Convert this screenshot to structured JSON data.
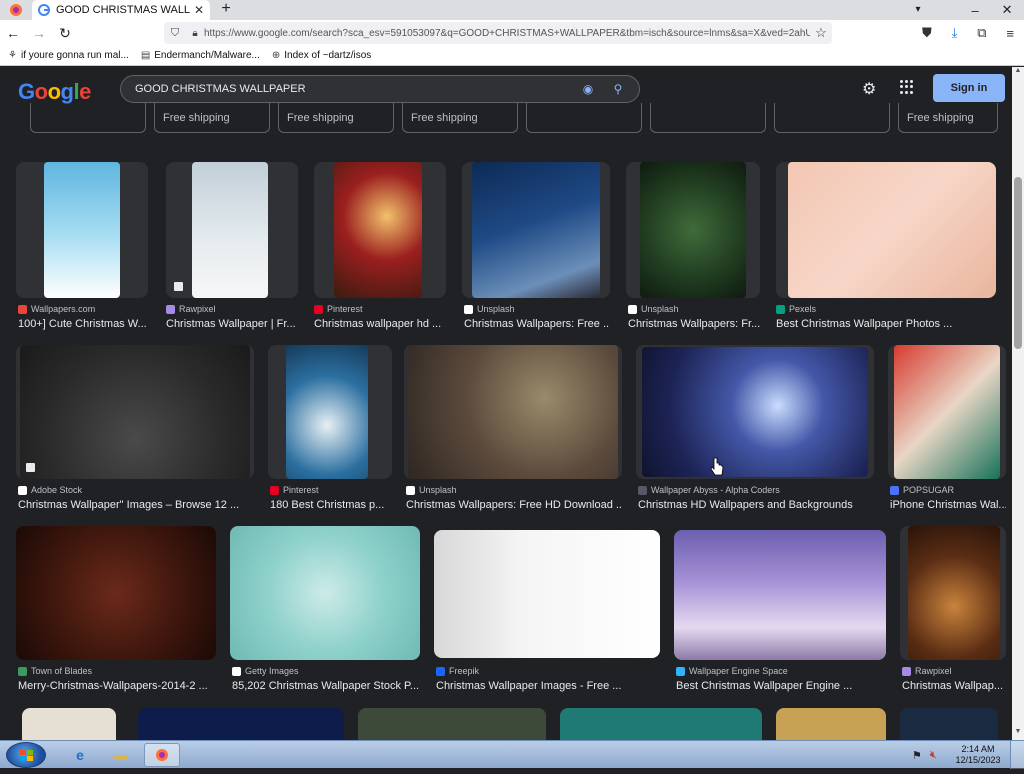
{
  "browser": {
    "tab_title": "GOOD CHRISTMAS WALLPAPER - G",
    "new_tab_symbol": "+",
    "url": "https://www.google.com/search?sca_esv=591053097&q=GOOD+CHRISTMAS+WALLPAPER&tbm=isch&source=lnms&sa=X&ved=2ahU",
    "bookmarks": [
      {
        "label": "if youre gonna run mal..."
      },
      {
        "label": "Endermanch/Malware..."
      },
      {
        "label": "Index of ~dartz/isos"
      }
    ]
  },
  "google": {
    "logo": "Google",
    "query": "GOOD CHRISTMAS WALLPAPER",
    "signin_label": "Sign in"
  },
  "chips": [
    {
      "label": ""
    },
    {
      "label": "Free shipping"
    },
    {
      "label": "Free shipping"
    },
    {
      "label": "Free shipping"
    },
    {
      "label": ""
    },
    {
      "label": ""
    },
    {
      "label": ""
    },
    {
      "label": "Free shipping"
    }
  ],
  "results": [
    {
      "source": "Wallpapers.com",
      "title": "100+] Cute Christmas W..."
    },
    {
      "source": "Rawpixel",
      "title": "Christmas Wallpaper | Fr..."
    },
    {
      "source": "Pinterest",
      "title": "Christmas wallpaper hd ..."
    },
    {
      "source": "Unsplash",
      "title": "Christmas Wallpapers: Free ..."
    },
    {
      "source": "Unsplash",
      "title": "Christmas Wallpapers: Fr..."
    },
    {
      "source": "Pexels",
      "title": "Best Christmas Wallpaper Photos ..."
    },
    {
      "source": "Adobe Stock",
      "title": "Christmas Wallpaper\" Images – Browse 12 ..."
    },
    {
      "source": "Pinterest",
      "title": "180 Best Christmas p..."
    },
    {
      "source": "Unsplash",
      "title": "Christmas Wallpapers: Free HD Download ..."
    },
    {
      "source": "Wallpaper Abyss - Alpha Coders",
      "title": "Christmas HD Wallpapers and Backgrounds"
    },
    {
      "source": "POPSUGAR",
      "title": "iPhone Christmas Wal..."
    },
    {
      "source": "Town of Blades",
      "title": "Merry-Christmas-Wallpapers-2014-2 ..."
    },
    {
      "source": "Getty Images",
      "title": "85,202 Christmas Wallpaper Stock P..."
    },
    {
      "source": "Freepik",
      "title": "Christmas Wallpaper Images - Free ..."
    },
    {
      "source": "Wallpaper Engine Space",
      "title": "Best Christmas Wallpaper Engine ..."
    },
    {
      "source": "Rawpixel",
      "title": "Christmas Wallpap..."
    }
  ],
  "taskbar": {
    "time": "2:14 AM",
    "date": "12/15/2023"
  }
}
